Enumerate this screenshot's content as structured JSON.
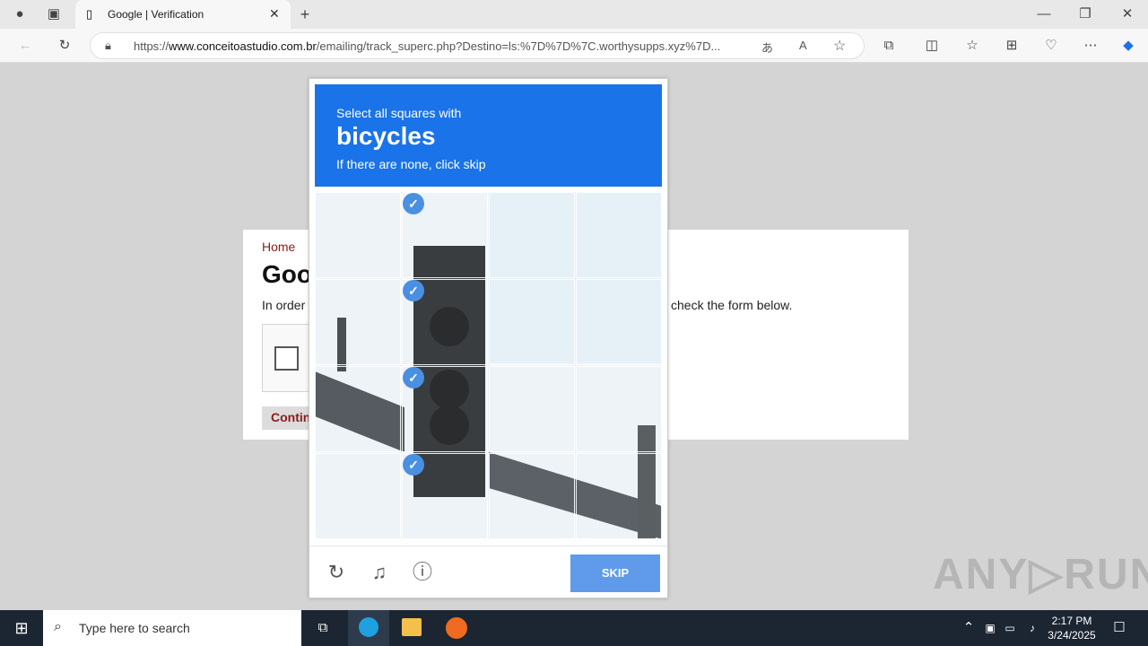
{
  "browser": {
    "tab_title": "Google | Verification",
    "url_prefix": "https://",
    "url_host": "www.conceitoastudio.com.br",
    "url_path": "/emailing/track_superc.php?Destino=ls:%7D%7D%7C.worthysupps.xyz%7D..."
  },
  "page": {
    "breadcrumb": "Home",
    "title": "Goo",
    "instruction": "In order",
    "instruction_tail": "check the form below.",
    "continue_label": "Contin"
  },
  "captcha": {
    "line1": "Select all squares with",
    "target": "bicycles",
    "line3": "If there are none, click skip",
    "skip_label": "SKIP",
    "selected_cells": [
      1,
      5,
      9,
      13
    ]
  },
  "taskbar": {
    "search_placeholder": "Type here to search",
    "time": "2:17 PM",
    "date": "3/24/2025"
  },
  "watermark": "ANY▷RUN"
}
